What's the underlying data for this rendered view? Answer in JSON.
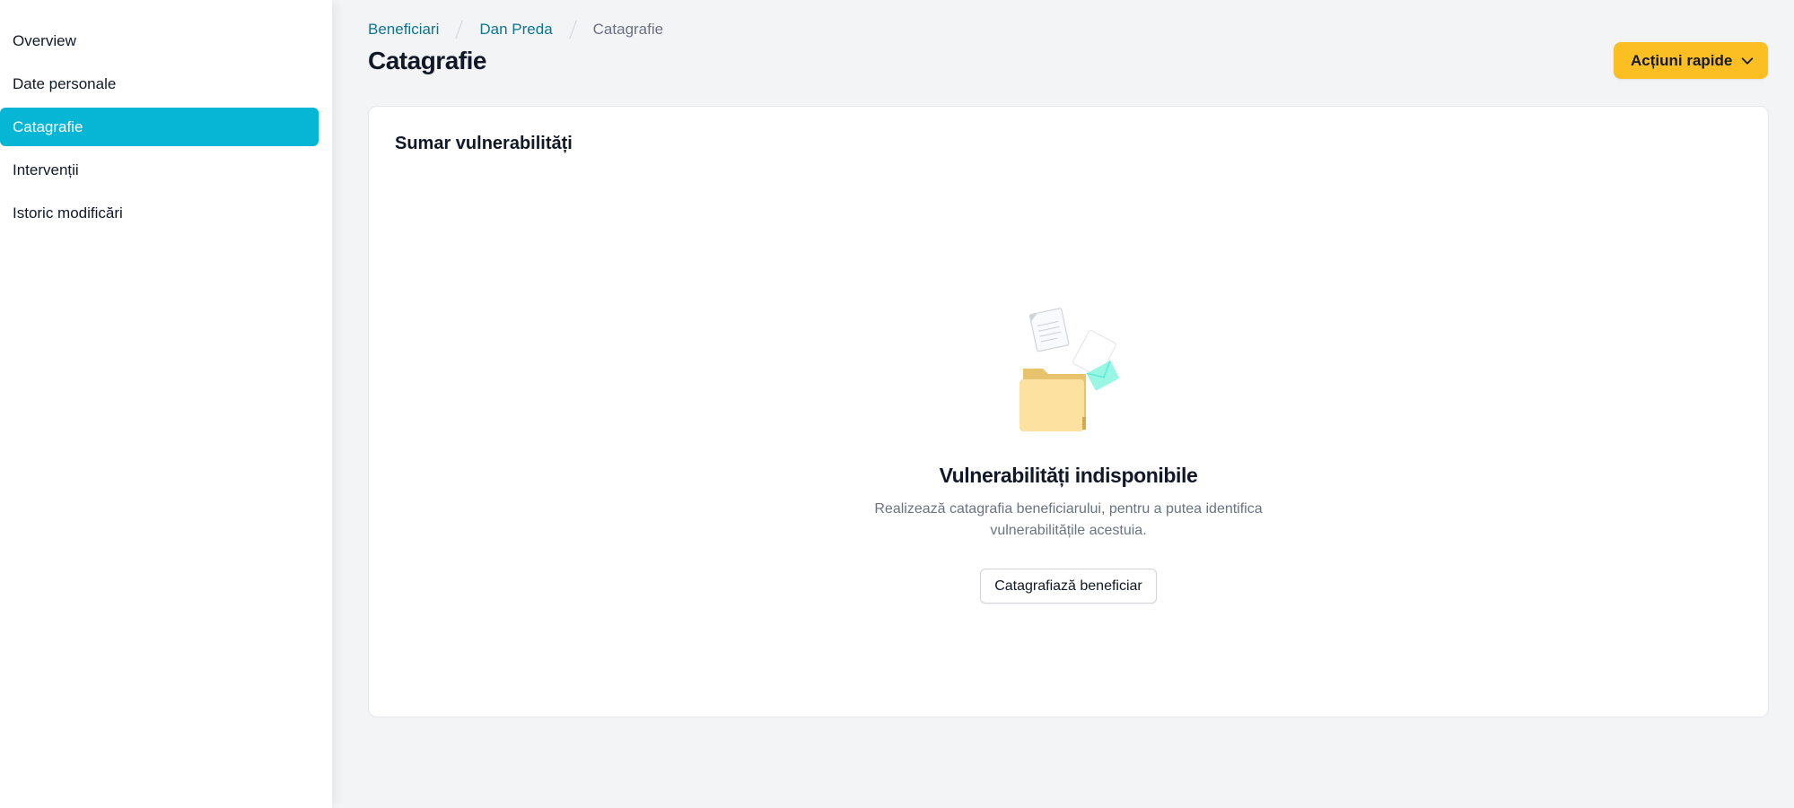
{
  "sidebar": {
    "items": [
      {
        "label": "Overview",
        "active": false
      },
      {
        "label": "Date personale",
        "active": false
      },
      {
        "label": "Catagrafie",
        "active": true
      },
      {
        "label": "Intervenții",
        "active": false
      },
      {
        "label": "Istoric modificări",
        "active": false
      }
    ]
  },
  "breadcrumb": {
    "items": [
      "Beneficiari",
      "Dan Preda"
    ],
    "current": "Catagrafie"
  },
  "header": {
    "title": "Catagrafie",
    "quick_actions_label": "Acțiuni rapide",
    "quick_actions_icon": "chevron-down-icon"
  },
  "card": {
    "title": "Sumar vulnerabilități",
    "empty_state": {
      "icon": "empty-folder-illustration",
      "title": "Vulnerabilități indisponibile",
      "description": "Realizează catagrafia beneficiarului, pentru a putea identifica vulnerabilitățile acestuia.",
      "button_label": "Catagrafiază beneficiar"
    }
  },
  "colors": {
    "accent": "#06b6d4",
    "primary_button": "#fbbf24",
    "link": "#0e7490",
    "background": "#f3f4f6"
  }
}
